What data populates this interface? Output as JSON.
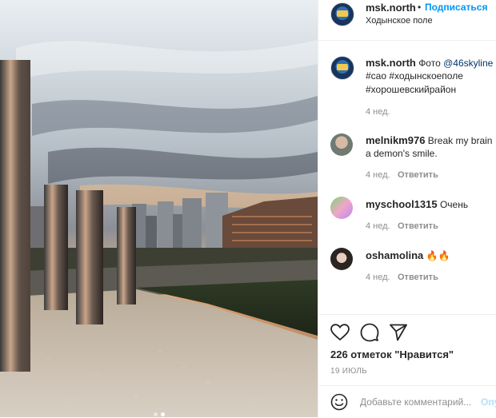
{
  "post": {
    "author": "msk.north",
    "follow_label": "Подписаться",
    "dot": "•",
    "location": "Ходынское поле",
    "caption_user": "msk.north",
    "caption_prefix": "Фото",
    "caption_mention": "@46skyline",
    "caption_tags_line1": "#сао #ходынскоеполе",
    "caption_tags_line2": "#хорошевскийрайон",
    "caption_time": "4 нед."
  },
  "comments": [
    {
      "user": "melnikm976",
      "text_line1": "Break my brain",
      "text_line2": "a demon's smile.",
      "time": "4 нед.",
      "reply": "Ответить"
    },
    {
      "user": "myschool1315",
      "text_line1": "Очень",
      "time": "4 нед.",
      "reply": "Ответить"
    },
    {
      "user": "oshamolina",
      "text_line1": "🔥🔥",
      "time": "4 нед.",
      "reply": "Ответить"
    }
  ],
  "stats": {
    "likes": "226 отметок \"Нравится\"",
    "date": "19 ИЮЛЬ"
  },
  "add_comment": {
    "placeholder": "Добавьте комментарий...",
    "post_label": "Опу"
  },
  "icons": {
    "like": "heart-icon",
    "comment": "comment-icon",
    "share": "share-icon",
    "emoji": "emoji-icon"
  },
  "colors": {
    "link": "#0095f6",
    "text": "#262626",
    "muted": "#8e8e8e",
    "border": "#efefef"
  }
}
